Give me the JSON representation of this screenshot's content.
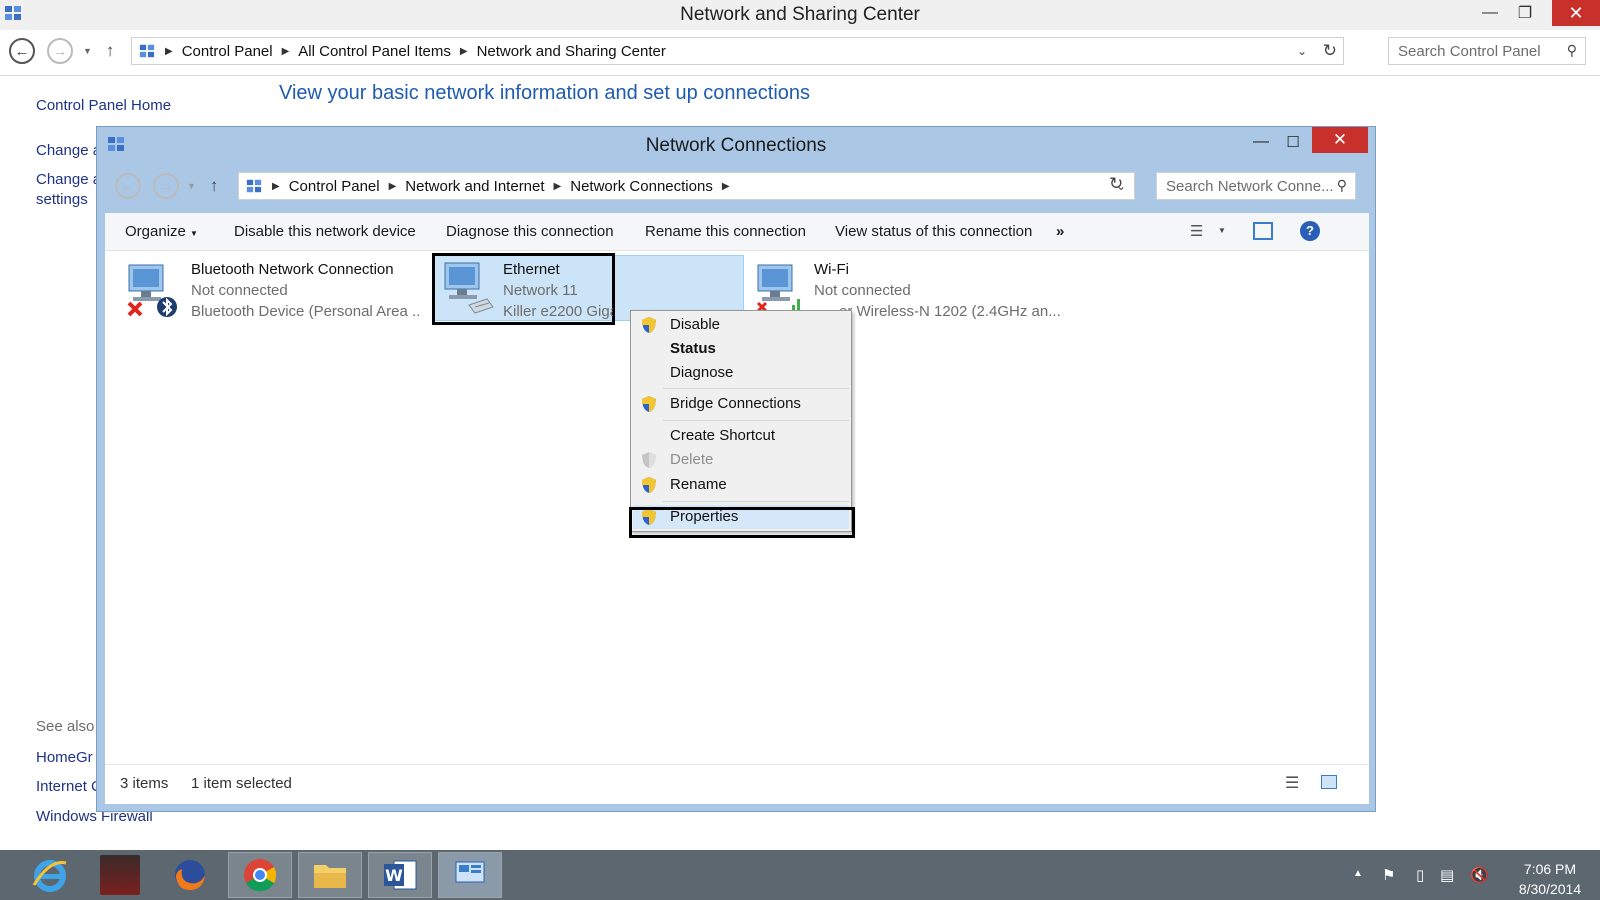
{
  "outer": {
    "title": "Network and Sharing Center",
    "breadcrumb": [
      "Control Panel",
      "All Control Panel Items",
      "Network and Sharing Center"
    ],
    "search_placeholder": "Search Control Panel",
    "left_nav": {
      "home": "Control Panel Home",
      "change_1": "Change a",
      "change_2_line1": "Change a",
      "change_2_line2": "settings",
      "see_also": "See also",
      "homegroup": "HomeGr",
      "internet": "Internet C",
      "firewall": "Windows Firewall"
    },
    "heading": "View your basic network information and set up connections"
  },
  "inner": {
    "title": "Network Connections",
    "breadcrumb": [
      "Control Panel",
      "Network and Internet",
      "Network Connections"
    ],
    "search_placeholder": "Search Network Conne...",
    "commands": {
      "organize": "Organize",
      "disable": "Disable this network device",
      "diagnose": "Diagnose this connection",
      "rename": "Rename this connection",
      "view_status": "View status of this connection",
      "more": "»"
    },
    "connections": [
      {
        "name": "Bluetooth Network Connection",
        "status": "Not connected",
        "device": "Bluetooth Device (Personal Area ..."
      },
      {
        "name": "Ethernet",
        "status": "Network  11",
        "device": "Killer e2200 Giga"
      },
      {
        "name": "Wi-Fi",
        "status": "Not connected",
        "device": "er Wireless-N 1202 (2.4GHz an..."
      }
    ],
    "status_bar": {
      "items": "3 items",
      "selected": "1 item selected"
    }
  },
  "context_menu": {
    "disable": "Disable",
    "status": "Status",
    "diagnose": "Diagnose",
    "bridge": "Bridge Connections",
    "shortcut": "Create Shortcut",
    "delete": "Delete",
    "rename": "Rename",
    "properties": "Properties"
  },
  "taskbar": {
    "apps": [
      "internet-explorer",
      "user-photo",
      "firefox",
      "chrome",
      "file-explorer",
      "word",
      "control-panel"
    ],
    "time": "7:06 PM",
    "date": "8/30/2014"
  },
  "colors": {
    "accent": "#1e5bb0",
    "close": "#c7302b",
    "inner_frame": "#aac8e6",
    "taskbar": "#5c6770",
    "selection": "#cce4f7"
  }
}
